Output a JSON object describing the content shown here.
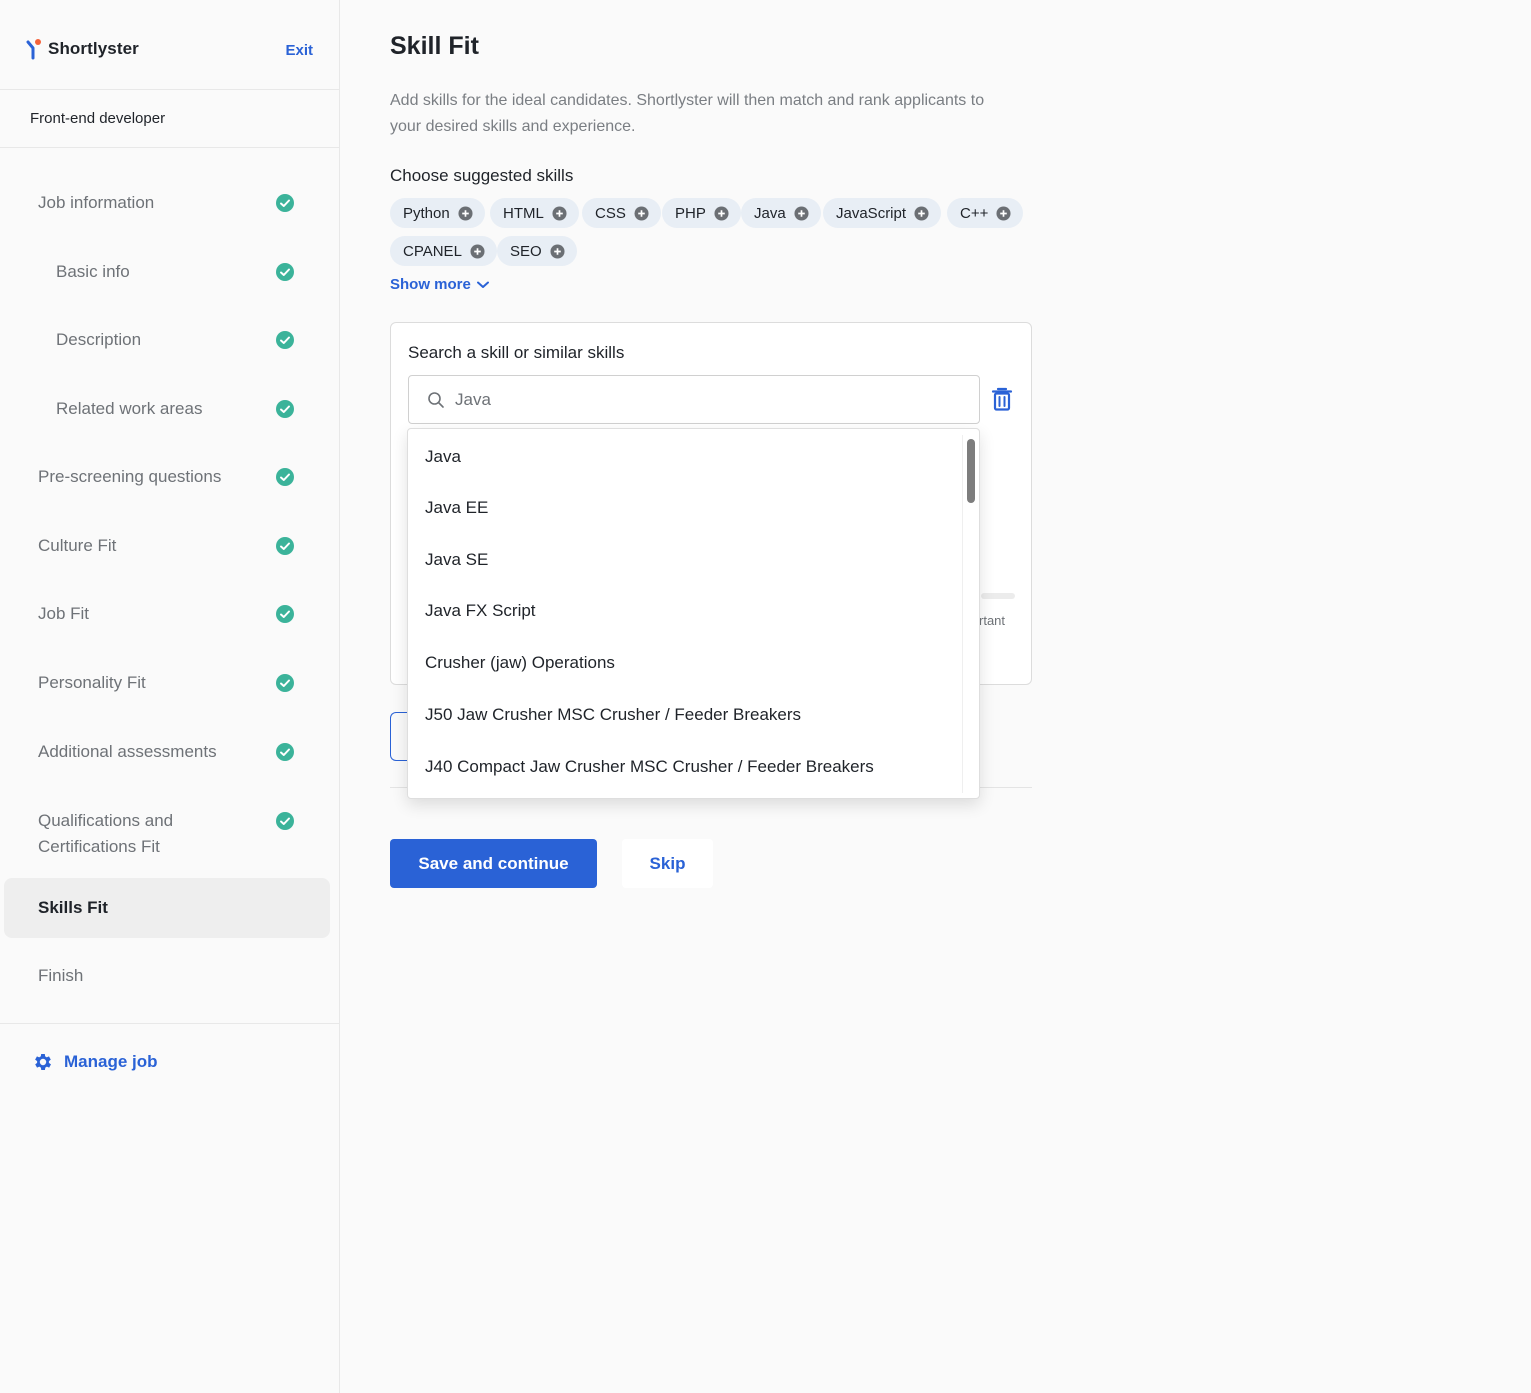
{
  "brand": {
    "name": "Shortlyster"
  },
  "header": {
    "exit_label": "Exit"
  },
  "job": {
    "title": "Front-end developer"
  },
  "steps": [
    {
      "label": "Job information",
      "done": true
    },
    {
      "label": "Basic info",
      "done": true
    },
    {
      "label": "Description",
      "done": true
    },
    {
      "label": "Related work areas",
      "done": true
    },
    {
      "label": "Pre-screening questions",
      "done": true
    },
    {
      "label": "Culture Fit",
      "done": true
    },
    {
      "label": "Job Fit",
      "done": true
    },
    {
      "label": "Personality Fit",
      "done": true
    },
    {
      "label": "Additional assessments",
      "done": true
    },
    {
      "label": "Qualifications and Certifications Fit",
      "line1": "Qualifications and",
      "line2": "Certifications Fit",
      "done": true
    },
    {
      "label": "Skills Fit",
      "active": true
    },
    {
      "label": "Finish"
    }
  ],
  "manage": {
    "label": "Manage job"
  },
  "page": {
    "title": "Skill Fit",
    "description": "Add skills for the ideal candidates. Shortlyster will then match and rank applicants to your desired skills and experience."
  },
  "suggested": {
    "title": "Choose suggested skills",
    "skills": [
      "Python",
      "HTML",
      "CSS",
      "PHP",
      "Java",
      "JavaScript",
      "C++",
      "CPANEL",
      "SEO"
    ],
    "show_more": "Show more"
  },
  "search": {
    "label": "Search a skill or similar skills",
    "value": "Java",
    "partial_importance_label": "rtant"
  },
  "dropdown": {
    "options": [
      "Java",
      "Java EE",
      "Java SE",
      "Java FX Script",
      "Crusher (jaw) Operations",
      "J50 Jaw Crusher MSC Crusher / Feeder Breakers",
      "J40 Compact Jaw Crusher MSC Crusher / Feeder Breakers"
    ]
  },
  "actions": {
    "save": "Save and continue",
    "skip": "Skip"
  },
  "colors": {
    "accent": "#2a62d6",
    "check": "#3bb39a",
    "chip_bg": "#e8eef5"
  }
}
